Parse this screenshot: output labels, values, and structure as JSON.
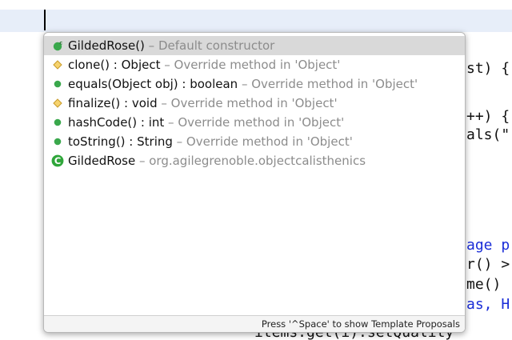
{
  "editor": {
    "code_fragments": [
      "st) {",
      "++) {",
      "als(\"",
      "age p",
      "r() >",
      "me()",
      "as, H",
      "items.get(i).setQuality"
    ]
  },
  "completion": {
    "items": [
      {
        "icon": "constructor-icon",
        "signature": "GildedRose()",
        "description": " – Default constructor",
        "selected": true
      },
      {
        "icon": "protected-method-icon",
        "signature": "clone() : Object",
        "description": " – Override method in 'Object'"
      },
      {
        "icon": "public-method-icon",
        "signature": "equals(Object obj) : boolean",
        "description": " – Override method in 'Object'"
      },
      {
        "icon": "protected-method-icon",
        "signature": "finalize() : void",
        "description": " – Override method in 'Object'"
      },
      {
        "icon": "public-method-icon",
        "signature": "hashCode() : int",
        "description": " – Override method in 'Object'"
      },
      {
        "icon": "public-method-icon",
        "signature": "toString() : String",
        "description": " – Override method in 'Object'"
      },
      {
        "icon": "class-icon",
        "signature": "GildedRose",
        "description": " – org.agilegrenoble.objectcalisthenics"
      }
    ],
    "footer_hint": "Press '^Space' to show Template Proposals"
  },
  "colors": {
    "public_method": "#3aa84c",
    "protected_method": "#e7b84a",
    "class": "#2fa63a",
    "selection": "#d9d9d9",
    "editor_highlight": "#e7eef9"
  }
}
